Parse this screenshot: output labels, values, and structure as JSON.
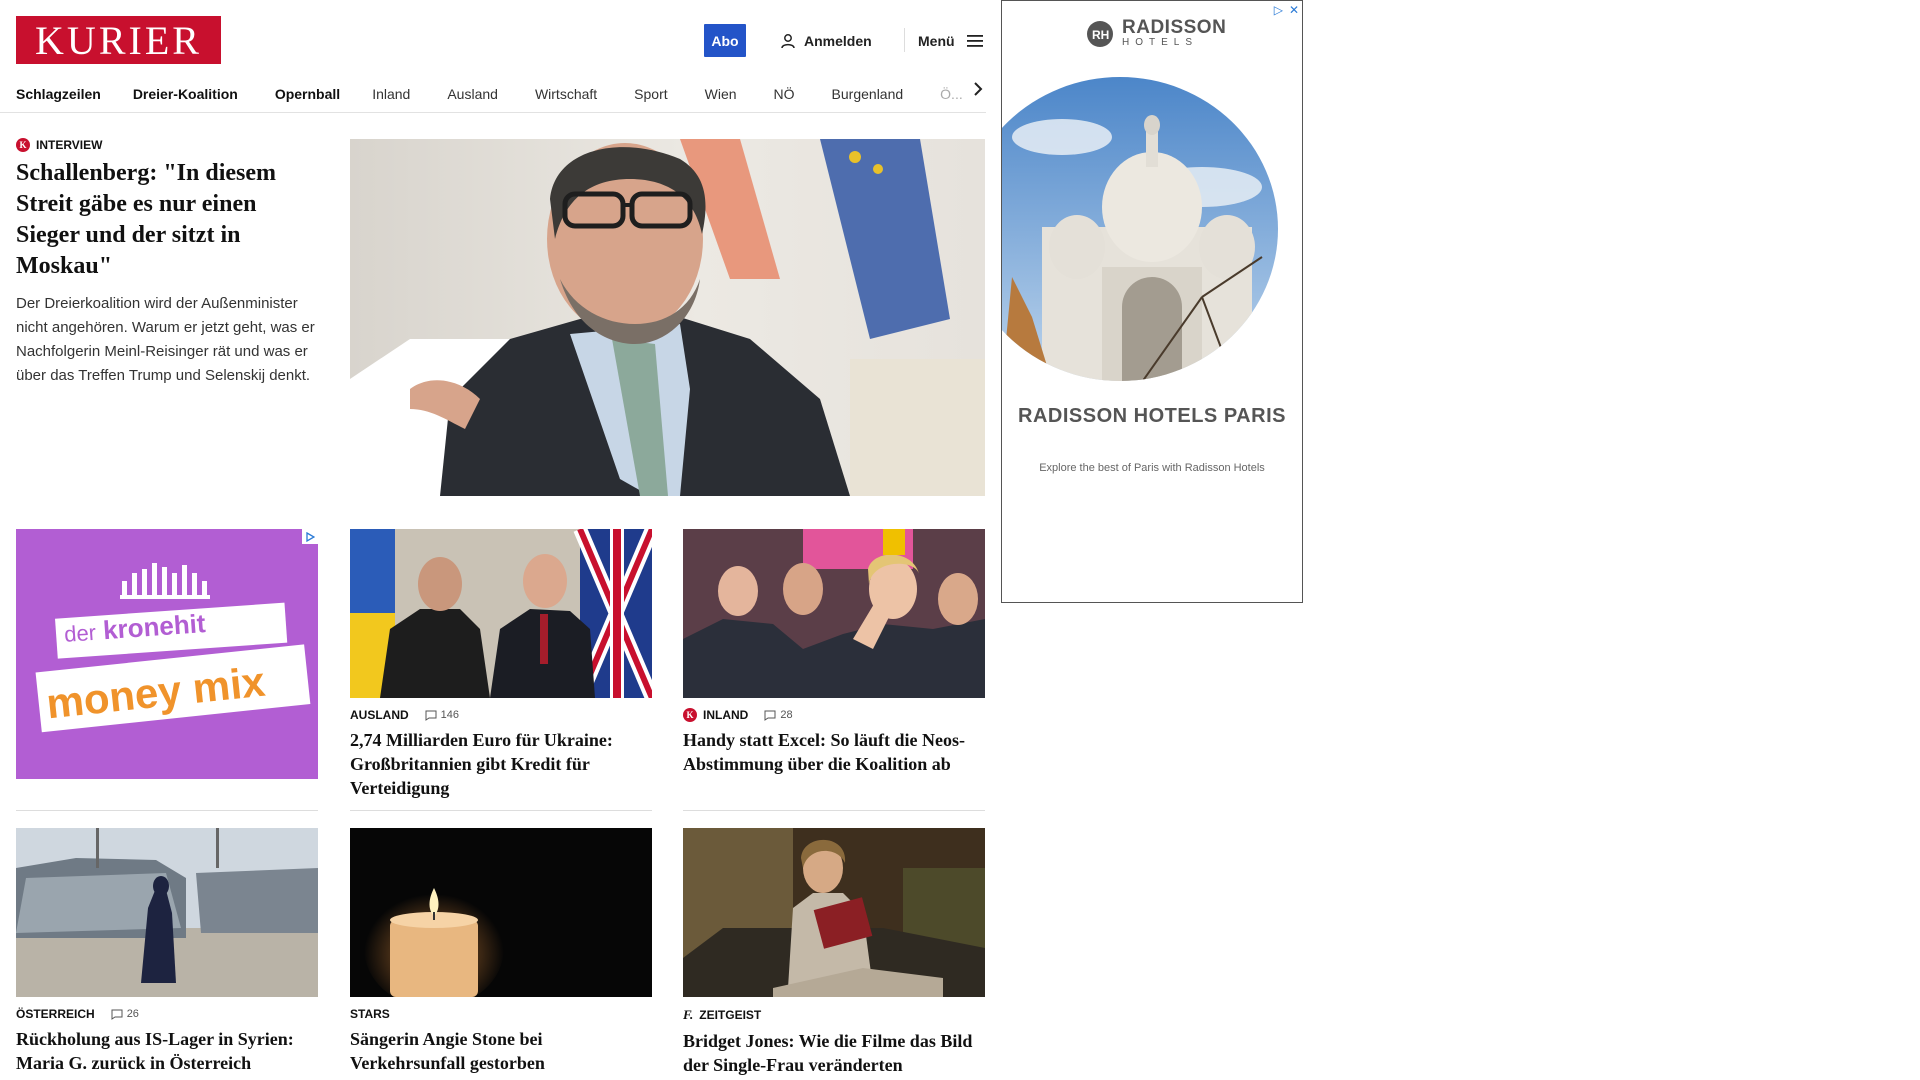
{
  "header": {
    "logo": "KURIER",
    "abo": "Abo",
    "login": "Anmelden",
    "menu": "Menü"
  },
  "nav": {
    "items": [
      "Schlagzeilen",
      "Dreier-Koalition",
      "Opernball",
      "Inland",
      "Ausland",
      "Wirtschaft",
      "Sport",
      "Wien",
      "NÖ",
      "Burgenland",
      "Ö..."
    ]
  },
  "lead": {
    "kicker": "INTERVIEW",
    "title": "Schallenberg: \"In diesem Streit gäbe es nur einen Sieger und der sitzt in Moskau\"",
    "teaser": "Der Dreierkoalition wird der Außenminister nicht angehören. Warum er jetzt geht, was er Nachfolgerin Meinl-Reisinger rät und was er über das Treffen Trump und Selenskij denkt."
  },
  "ad_left": {
    "line1": "der",
    "line2": "kronehit",
    "line3": "money mix"
  },
  "cards": [
    {
      "kicker": "AUSLAND",
      "comments": "146",
      "title": "2,74 Milliarden Euro für Ukraine: Großbritannien gibt Kredit für Verteidigung"
    },
    {
      "kicker": "INLAND",
      "comments": "28",
      "title": "Handy statt Excel: So läuft die Neos-Abstimmung über die Koalition ab"
    },
    {
      "kicker": "ÖSTERREICH",
      "comments": "26",
      "title": "Rückholung aus IS-Lager in Syrien: Maria G. zurück in Österreich"
    },
    {
      "kicker": "STARS",
      "comments": "",
      "title": "Sängerin Angie Stone bei Verkehrsunfall gestorben"
    },
    {
      "kicker": "ZEITGEIST",
      "comments": "",
      "title": "Bridget Jones: Wie die Filme das Bild der Single-Frau veränderten"
    }
  ],
  "ad_right": {
    "brand": "RADISSON",
    "brand_sub": "HOTELS",
    "headline": "RADISSON HOTELS PARIS",
    "sub": "Explore the best of Paris with Radisson Hotels"
  },
  "colors": {
    "brand_red": "#c8102e",
    "abo_blue": "#2354c8",
    "ad_purple": "#b25ed3"
  }
}
